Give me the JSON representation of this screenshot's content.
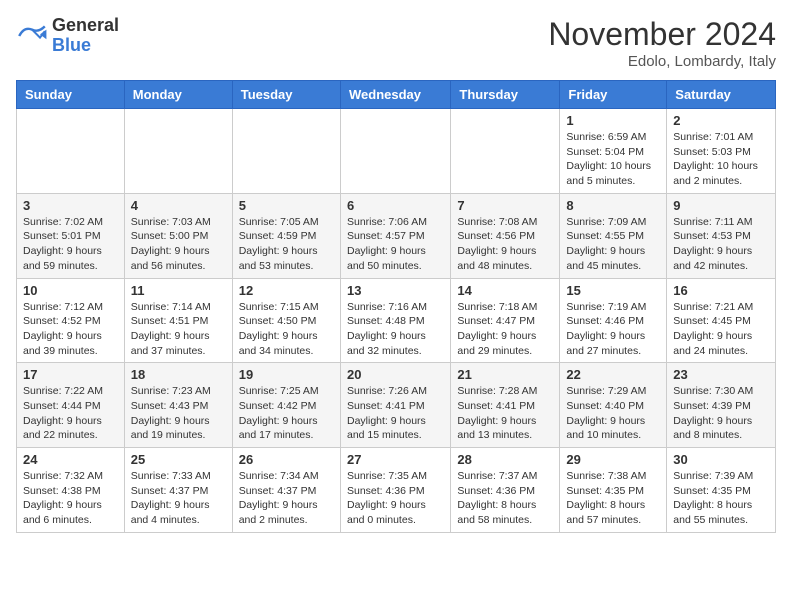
{
  "logo": {
    "general": "General",
    "blue": "Blue"
  },
  "title": "November 2024",
  "location": "Edolo, Lombardy, Italy",
  "weekdays": [
    "Sunday",
    "Monday",
    "Tuesday",
    "Wednesday",
    "Thursday",
    "Friday",
    "Saturday"
  ],
  "rows": [
    [
      {
        "day": "",
        "info": ""
      },
      {
        "day": "",
        "info": ""
      },
      {
        "day": "",
        "info": ""
      },
      {
        "day": "",
        "info": ""
      },
      {
        "day": "",
        "info": ""
      },
      {
        "day": "1",
        "info": "Sunrise: 6:59 AM\nSunset: 5:04 PM\nDaylight: 10 hours\nand 5 minutes."
      },
      {
        "day": "2",
        "info": "Sunrise: 7:01 AM\nSunset: 5:03 PM\nDaylight: 10 hours\nand 2 minutes."
      }
    ],
    [
      {
        "day": "3",
        "info": "Sunrise: 7:02 AM\nSunset: 5:01 PM\nDaylight: 9 hours\nand 59 minutes."
      },
      {
        "day": "4",
        "info": "Sunrise: 7:03 AM\nSunset: 5:00 PM\nDaylight: 9 hours\nand 56 minutes."
      },
      {
        "day": "5",
        "info": "Sunrise: 7:05 AM\nSunset: 4:59 PM\nDaylight: 9 hours\nand 53 minutes."
      },
      {
        "day": "6",
        "info": "Sunrise: 7:06 AM\nSunset: 4:57 PM\nDaylight: 9 hours\nand 50 minutes."
      },
      {
        "day": "7",
        "info": "Sunrise: 7:08 AM\nSunset: 4:56 PM\nDaylight: 9 hours\nand 48 minutes."
      },
      {
        "day": "8",
        "info": "Sunrise: 7:09 AM\nSunset: 4:55 PM\nDaylight: 9 hours\nand 45 minutes."
      },
      {
        "day": "9",
        "info": "Sunrise: 7:11 AM\nSunset: 4:53 PM\nDaylight: 9 hours\nand 42 minutes."
      }
    ],
    [
      {
        "day": "10",
        "info": "Sunrise: 7:12 AM\nSunset: 4:52 PM\nDaylight: 9 hours\nand 39 minutes."
      },
      {
        "day": "11",
        "info": "Sunrise: 7:14 AM\nSunset: 4:51 PM\nDaylight: 9 hours\nand 37 minutes."
      },
      {
        "day": "12",
        "info": "Sunrise: 7:15 AM\nSunset: 4:50 PM\nDaylight: 9 hours\nand 34 minutes."
      },
      {
        "day": "13",
        "info": "Sunrise: 7:16 AM\nSunset: 4:48 PM\nDaylight: 9 hours\nand 32 minutes."
      },
      {
        "day": "14",
        "info": "Sunrise: 7:18 AM\nSunset: 4:47 PM\nDaylight: 9 hours\nand 29 minutes."
      },
      {
        "day": "15",
        "info": "Sunrise: 7:19 AM\nSunset: 4:46 PM\nDaylight: 9 hours\nand 27 minutes."
      },
      {
        "day": "16",
        "info": "Sunrise: 7:21 AM\nSunset: 4:45 PM\nDaylight: 9 hours\nand 24 minutes."
      }
    ],
    [
      {
        "day": "17",
        "info": "Sunrise: 7:22 AM\nSunset: 4:44 PM\nDaylight: 9 hours\nand 22 minutes."
      },
      {
        "day": "18",
        "info": "Sunrise: 7:23 AM\nSunset: 4:43 PM\nDaylight: 9 hours\nand 19 minutes."
      },
      {
        "day": "19",
        "info": "Sunrise: 7:25 AM\nSunset: 4:42 PM\nDaylight: 9 hours\nand 17 minutes."
      },
      {
        "day": "20",
        "info": "Sunrise: 7:26 AM\nSunset: 4:41 PM\nDaylight: 9 hours\nand 15 minutes."
      },
      {
        "day": "21",
        "info": "Sunrise: 7:28 AM\nSunset: 4:41 PM\nDaylight: 9 hours\nand 13 minutes."
      },
      {
        "day": "22",
        "info": "Sunrise: 7:29 AM\nSunset: 4:40 PM\nDaylight: 9 hours\nand 10 minutes."
      },
      {
        "day": "23",
        "info": "Sunrise: 7:30 AM\nSunset: 4:39 PM\nDaylight: 9 hours\nand 8 minutes."
      }
    ],
    [
      {
        "day": "24",
        "info": "Sunrise: 7:32 AM\nSunset: 4:38 PM\nDaylight: 9 hours\nand 6 minutes."
      },
      {
        "day": "25",
        "info": "Sunrise: 7:33 AM\nSunset: 4:37 PM\nDaylight: 9 hours\nand 4 minutes."
      },
      {
        "day": "26",
        "info": "Sunrise: 7:34 AM\nSunset: 4:37 PM\nDaylight: 9 hours\nand 2 minutes."
      },
      {
        "day": "27",
        "info": "Sunrise: 7:35 AM\nSunset: 4:36 PM\nDaylight: 9 hours\nand 0 minutes."
      },
      {
        "day": "28",
        "info": "Sunrise: 7:37 AM\nSunset: 4:36 PM\nDaylight: 8 hours\nand 58 minutes."
      },
      {
        "day": "29",
        "info": "Sunrise: 7:38 AM\nSunset: 4:35 PM\nDaylight: 8 hours\nand 57 minutes."
      },
      {
        "day": "30",
        "info": "Sunrise: 7:39 AM\nSunset: 4:35 PM\nDaylight: 8 hours\nand 55 minutes."
      }
    ]
  ]
}
